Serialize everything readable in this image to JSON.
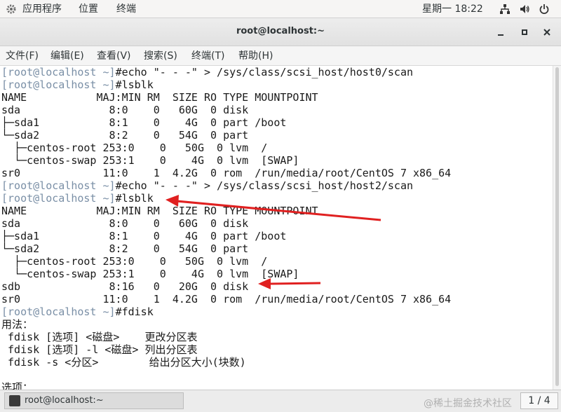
{
  "topbar": {
    "applications": "应用程序",
    "places": "位置",
    "terminal": "终端",
    "clock": "星期一 18:22",
    "icons": [
      "network-icon",
      "volume-icon",
      "power-icon"
    ]
  },
  "window": {
    "title": "root@localhost:~",
    "buttons": [
      "minimize-icon",
      "maximize-icon",
      "close-icon"
    ]
  },
  "menu": [
    "文件(F)",
    "编辑(E)",
    "查看(V)",
    "搜索(S)",
    "终端(T)",
    "帮助(H)"
  ],
  "terminal_lines": [
    {
      "prompt": "[root@localhost ~]",
      "text": "#echo \"- - -\" > /sys/class/scsi_host/host0/scan"
    },
    {
      "prompt": "[root@localhost ~]",
      "text": "#lsblk"
    },
    {
      "prompt": "",
      "text": "NAME           MAJ:MIN RM  SIZE RO TYPE MOUNTPOINT"
    },
    {
      "prompt": "",
      "text": "sda              8:0    0   60G  0 disk"
    },
    {
      "prompt": "",
      "text": "├─sda1           8:1    0    4G  0 part /boot"
    },
    {
      "prompt": "",
      "text": "└─sda2           8:2    0   54G  0 part"
    },
    {
      "prompt": "",
      "text": "  ├─centos-root 253:0    0   50G  0 lvm  /"
    },
    {
      "prompt": "",
      "text": "  └─centos-swap 253:1    0    4G  0 lvm  [SWAP]"
    },
    {
      "prompt": "",
      "text": "sr0             11:0    1  4.2G  0 rom  /run/media/root/CentOS 7 x86_64"
    },
    {
      "prompt": "[root@localhost ~]",
      "text": "#echo \"- - -\" > /sys/class/scsi_host/host2/scan"
    },
    {
      "prompt": "[root@localhost ~]",
      "text": "#lsblk"
    },
    {
      "prompt": "",
      "text": "NAME           MAJ:MIN RM  SIZE RO TYPE MOUNTPOINT"
    },
    {
      "prompt": "",
      "text": "sda              8:0    0   60G  0 disk"
    },
    {
      "prompt": "",
      "text": "├─sda1           8:1    0    4G  0 part /boot"
    },
    {
      "prompt": "",
      "text": "└─sda2           8:2    0   54G  0 part"
    },
    {
      "prompt": "",
      "text": "  ├─centos-root 253:0    0   50G  0 lvm  /"
    },
    {
      "prompt": "",
      "text": "  └─centos-swap 253:1    0    4G  0 lvm  [SWAP]"
    },
    {
      "prompt": "",
      "text": "sdb              8:16   0   20G  0 disk"
    },
    {
      "prompt": "",
      "text": "sr0             11:0    1  4.2G  0 rom  /run/media/root/CentOS 7 x86_64"
    },
    {
      "prompt": "[root@localhost ~]",
      "text": "#fdisk"
    },
    {
      "prompt": "",
      "text": "用法："
    },
    {
      "prompt": "",
      "text": " fdisk [选项] <磁盘>    更改分区表"
    },
    {
      "prompt": "",
      "text": " fdisk [选项] -l <磁盘> 列出分区表"
    },
    {
      "prompt": "",
      "text": " fdisk -s <分区>        给出分区大小(块数)"
    },
    {
      "prompt": "",
      "text": ""
    },
    {
      "prompt": "",
      "text": "选项："
    }
  ],
  "taskbar": {
    "task_label": "root@localhost:~",
    "watermark": "@稀土掘金技术社区",
    "pager": "1 / 4"
  },
  "colors": {
    "prompt": "#7a8fa6",
    "arrow": "#e02020"
  }
}
